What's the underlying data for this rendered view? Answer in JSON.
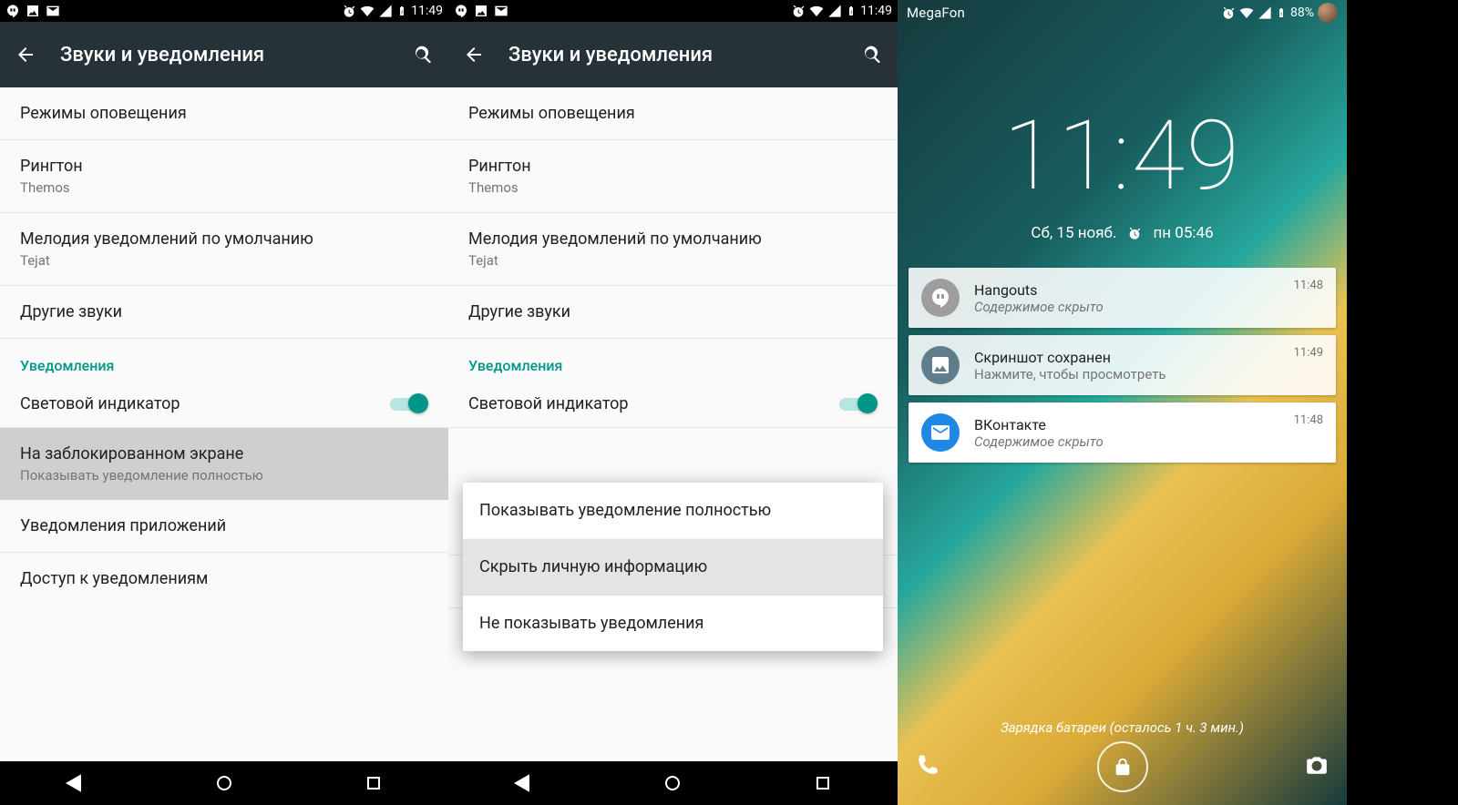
{
  "status": {
    "time": "11:49",
    "battery_pct": "88%"
  },
  "settings": {
    "action_bar_title": "Звуки и уведомления",
    "rows": {
      "modes": "Режимы оповещения",
      "ringtone": {
        "label": "Рингтон",
        "value": "Themos"
      },
      "notif_sound": {
        "label": "Мелодия уведомлений по умолчанию",
        "value": "Tejat"
      },
      "other_sounds": "Другие звуки",
      "section": "Уведомления",
      "led": "Световой индикатор",
      "lock_screen": {
        "label": "На заблокированном экране",
        "value": "Показывать уведомление полностью"
      },
      "app_notif": "Уведомления приложений",
      "notif_access": "Доступ к уведомлениям"
    },
    "popup": {
      "options": [
        "Показывать уведомление полностью",
        "Скрыть личную информацию",
        "Не показывать уведомления"
      ]
    }
  },
  "lockscreen": {
    "carrier": "MegaFon",
    "time": "11:49",
    "date": "Сб, 15 нояб.",
    "alarm": "пн 05:46",
    "charging": "Зарядка батареи (осталось 1 ч. 3 мин.)",
    "notifications": [
      {
        "app": "Hangouts",
        "text": "Содержимое скрыто",
        "time": "11:48",
        "icon": "hangouts",
        "bg": "#9e9e9e"
      },
      {
        "app": "Скриншот сохранен",
        "text": "Нажмите, чтобы просмотреть",
        "time": "11:49",
        "icon": "image",
        "bg": "#607d8b"
      },
      {
        "app": "ВКонтакте",
        "text": "Содержимое скрыто",
        "time": "11:48",
        "icon": "mail",
        "bg": "#1e88e5"
      }
    ]
  }
}
